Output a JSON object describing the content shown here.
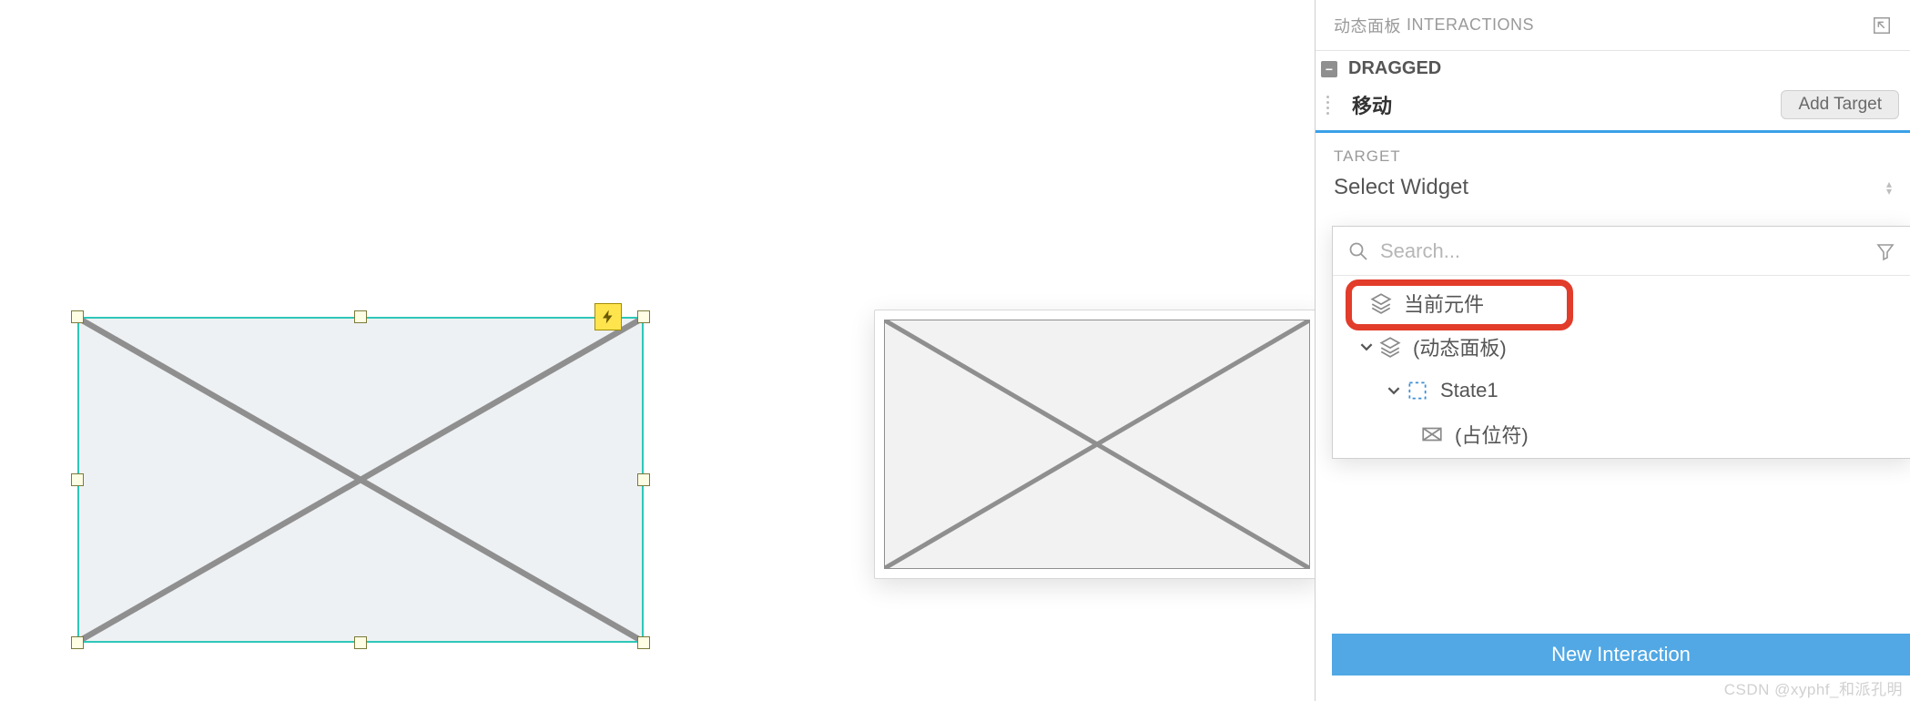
{
  "panel": {
    "header_prefix": "动态面板",
    "header_label": "INTERACTIONS",
    "event_name": "DRAGGED",
    "action_name": "移动",
    "add_target_label": "Add Target",
    "target_section_label": "TARGET",
    "select_widget_label": "Select Widget"
  },
  "dropdown": {
    "search_placeholder": "Search...",
    "items": [
      {
        "label": "当前元件",
        "icon": "layers",
        "indent": 40
      },
      {
        "label": "(动态面板)",
        "icon": "layers",
        "indent": 30,
        "caret": true
      },
      {
        "label": "State1",
        "icon": "state",
        "indent": 60,
        "caret": true
      },
      {
        "label": "(占位符)",
        "icon": "placeholder",
        "indent": 96
      }
    ]
  },
  "footer": {
    "new_interaction_label": "New Interaction"
  },
  "watermark": "CSDN @xyphf_和派孔明"
}
